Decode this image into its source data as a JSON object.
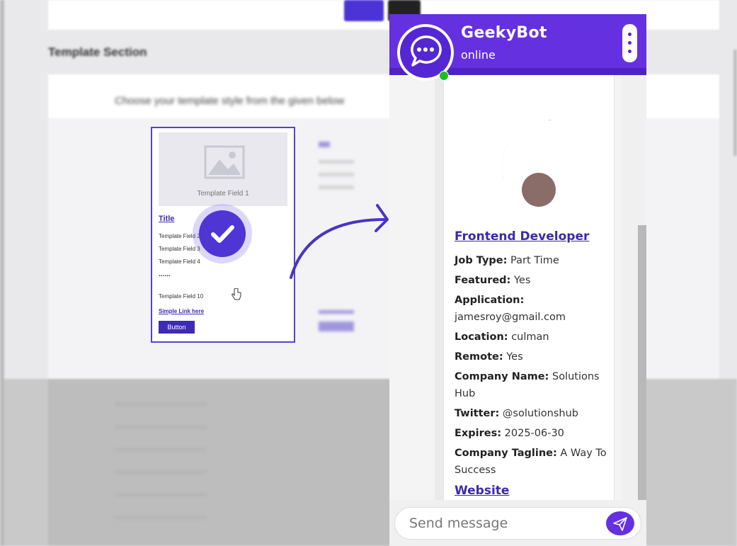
{
  "background": {
    "section_heading": "Template Section",
    "subtitle": "Choose your template style from the given below",
    "template": {
      "image_label": "Template Field 1",
      "title": "Title",
      "fields": [
        "Template Field 2",
        "Template Field 3",
        "Template Field 4"
      ],
      "ellipsis": "......",
      "last_field": "Template Field 10",
      "link": "Simple Link here",
      "button": "Button"
    }
  },
  "chat": {
    "bot_name": "GeekyBot",
    "status": "online",
    "colors": {
      "header": "#6530e0",
      "online": "#1bbf22",
      "link": "#3b2aa8"
    },
    "job": {
      "title": "Frontend Developer",
      "fields": [
        {
          "label": "Job Type:",
          "value": "Part Time"
        },
        {
          "label": "Featured:",
          "value": "Yes"
        },
        {
          "label": "Application:",
          "value": "jamesroy@gmail.com"
        },
        {
          "label": "Location:",
          "value": "culman"
        },
        {
          "label": "Remote:",
          "value": "Yes"
        },
        {
          "label": "Company Name:",
          "value": "Solutions Hub"
        },
        {
          "label": "Twitter:",
          "value": "@solutionshub"
        },
        {
          "label": "Expires:",
          "value": "2025-06-30"
        },
        {
          "label": "Company Tagline:",
          "value": "A Way To Success"
        }
      ],
      "website": "Website"
    },
    "input_placeholder": "Send message"
  }
}
